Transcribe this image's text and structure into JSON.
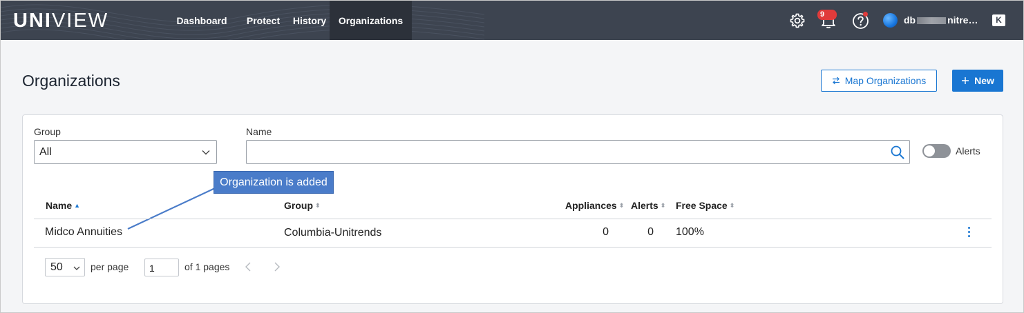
{
  "topbar": {
    "logo_bold": "UNI",
    "logo_thin": "VIEW",
    "nav": [
      {
        "label": "Dashboard",
        "active": false
      },
      {
        "label": "Protect",
        "active": false
      },
      {
        "label": "History",
        "active": false
      },
      {
        "label": "Organizations",
        "active": true
      }
    ],
    "notifications_badge": "9",
    "user_prefix": "db",
    "user_suffix": "nitre…",
    "collapse_glyph": "K",
    "icons": [
      "settings-gear-icon",
      "bell-icon",
      "help-icon",
      "avatar"
    ]
  },
  "page": {
    "title": "Organizations",
    "map_button": "Map Organizations",
    "new_button": "New"
  },
  "filters": {
    "group_label": "Group",
    "group_value": "All",
    "name_label": "Name",
    "name_value": "",
    "name_placeholder": "",
    "alerts_toggle_label": "Alerts",
    "alerts_toggle_on": false
  },
  "callout": {
    "text": "Organization is added"
  },
  "table": {
    "columns": [
      "Name",
      "Group",
      "Appliances",
      "Alerts",
      "Free Space"
    ],
    "sorted_column": "Name",
    "sort_direction": "ascending",
    "rows": [
      {
        "name": "Midco Annuities",
        "group": "Columbia-Unitrends",
        "appliances": "0",
        "alerts": "0",
        "free_space": "100%"
      }
    ]
  },
  "pagination": {
    "per_page_value": "50",
    "per_page_label": "per page",
    "page_value": "1",
    "of_pages": "of 1 pages"
  },
  "colors": {
    "topbar_bg": "#3d4450",
    "active_nav_bg": "#2c313a",
    "accent": "#1976d2",
    "badge": "#e03b3b",
    "callout_bg": "#4a7cc9"
  }
}
